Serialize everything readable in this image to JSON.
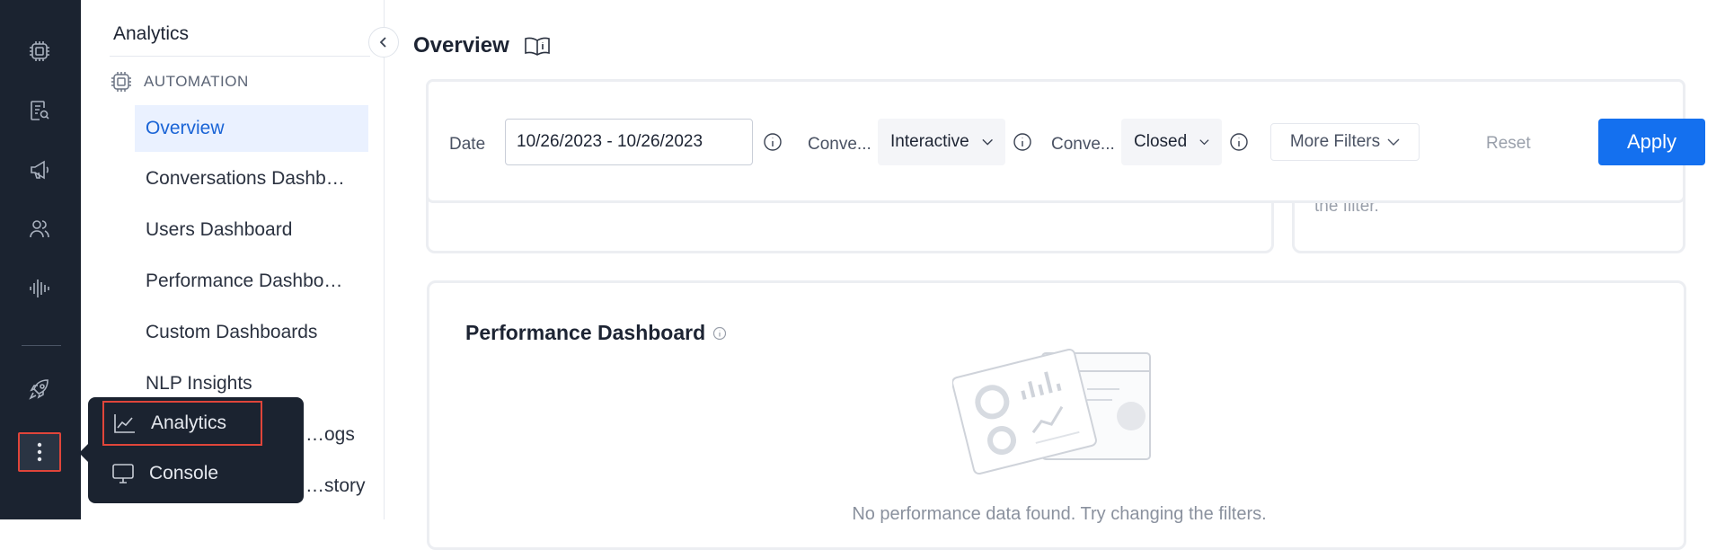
{
  "rail": {
    "icons": [
      "automation-chip-icon",
      "search-document-icon",
      "megaphone-icon",
      "users-icon",
      "voice-waveform-icon",
      "rocket-icon"
    ],
    "more_icon": "kebab-vertical-icon"
  },
  "nav": {
    "title": "Analytics",
    "section_label": "AUTOMATION",
    "items": [
      {
        "label": "Overview",
        "active": true
      },
      {
        "label": "Conversations Dashb…"
      },
      {
        "label": "Users Dashboard"
      },
      {
        "label": "Performance Dashbo…"
      },
      {
        "label": "Custom Dashboards"
      },
      {
        "label": "NLP Insights"
      },
      {
        "label": "…ogs"
      },
      {
        "label": "…story"
      }
    ]
  },
  "popup": {
    "items": [
      {
        "label": "Analytics",
        "icon": "line-chart-icon"
      },
      {
        "label": "Console",
        "icon": "monitor-icon"
      }
    ]
  },
  "header": {
    "title": "Overview",
    "doc_icon": "book-info-icon"
  },
  "background_card": {
    "faded_text": "the filter."
  },
  "filters": {
    "date_label": "Date",
    "date_value": "10/26/2023 - 10/26/2023",
    "conv1_label": "Conve...",
    "conv1_value": "Interactive",
    "conv2_label": "Conve...",
    "conv2_value": "Closed",
    "more_filters": "More Filters",
    "reset": "Reset",
    "apply": "Apply"
  },
  "performance": {
    "title": "Performance Dashboard",
    "empty_message": "No performance data found. Try changing the filters."
  },
  "colors": {
    "rail_bg": "#1b2330",
    "accent": "#1470ef",
    "highlight_border": "#e0453a",
    "active_bg": "#eaf1ff"
  }
}
